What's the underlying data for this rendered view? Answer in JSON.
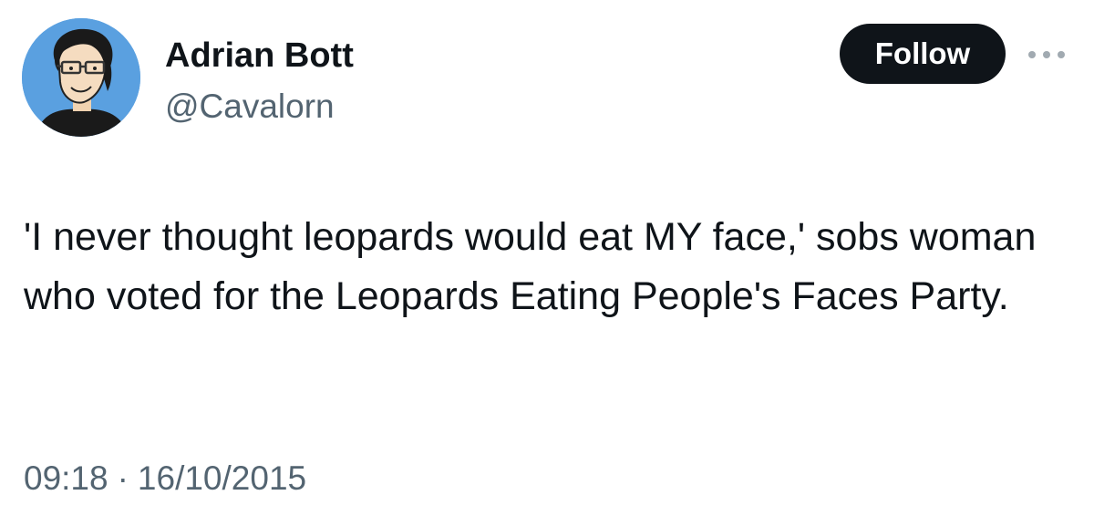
{
  "author": {
    "name": "Adrian Bott",
    "handle": "@Cavalorn",
    "avatar_icon": "cartoon-avatar-icon"
  },
  "actions": {
    "follow_label": "Follow",
    "more_icon": "more-horizontal-icon"
  },
  "tweet": {
    "text": "'I never thought leopards would eat MY face,' sobs woman who voted for the Leopards Eating People's Faces Party.",
    "time": "09:18",
    "separator": "·",
    "date": "16/10/2015"
  },
  "colors": {
    "text": "#0f1419",
    "secondary": "#536471",
    "button_bg": "#0f1419",
    "button_text": "#ffffff",
    "avatar_bg": "#5aa0e0"
  }
}
